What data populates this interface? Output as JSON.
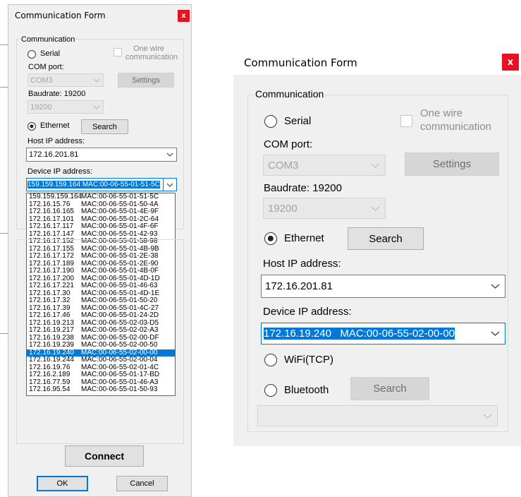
{
  "left_window": {
    "title": "Communication Form",
    "close_glyph": "x",
    "group_label": "Communication",
    "serial_label": "Serial",
    "one_wire_label_line1": "One wire",
    "one_wire_label_line2": "communication",
    "com_port_label": "COM port:",
    "com_port_value": "COM3",
    "settings_button": "Settings",
    "baudrate_label": "Baudrate: 19200",
    "baudrate_value": "19200",
    "ethernet_label": "Ethernet",
    "search_button": "Search",
    "host_ip_label": "Host IP address:",
    "host_ip_value": "172.16.201.81",
    "device_ip_label": "Device IP address:",
    "device_ip_value": "159.159.159.164 MAC:00-06-55-01-51-5C",
    "device_list": [
      {
        "ip": "159.159.159.164",
        "mac": "MAC:00-06-55-01-51-5C"
      },
      {
        "ip": "172.16.15.76",
        "mac": "MAC:00-06-55-01-50-4A"
      },
      {
        "ip": "172.16.16.165",
        "mac": "MAC:00-06-55-01-4E-9F"
      },
      {
        "ip": "172.16.17.101",
        "mac": "MAC:00-06-55-01-2C-64"
      },
      {
        "ip": "172.16.17.117",
        "mac": "MAC:00-06-55-01-4F-6F"
      },
      {
        "ip": "172.16.17.147",
        "mac": "MAC:00-06-55-01-42-93"
      },
      {
        "ip": "172.16.17.152",
        "mac": "MAC:00-06-55-01-58-98"
      },
      {
        "ip": "172.16.17.155",
        "mac": "MAC:00-06-55-01-4B-9B"
      },
      {
        "ip": "172.16.17.172",
        "mac": "MAC:00-06-55-01-2E-38"
      },
      {
        "ip": "172.16.17.189",
        "mac": "MAC:00-06-55-01-2E-90"
      },
      {
        "ip": "172.16.17.190",
        "mac": "MAC:00-06-55-01-4B-0F"
      },
      {
        "ip": "172.16.17.200",
        "mac": "MAC:00-06-55-01-4D-1D"
      },
      {
        "ip": "172.16.17.221",
        "mac": "MAC:00-06-55-01-46-63"
      },
      {
        "ip": "172.16.17.30",
        "mac": "MAC:00-06-55-01-4D-1E"
      },
      {
        "ip": "172.16.17.32",
        "mac": "MAC:00-06-55-01-50-20"
      },
      {
        "ip": "172.16.17.39",
        "mac": "MAC:00-06-55-01-4C-27"
      },
      {
        "ip": "172.16.17.46",
        "mac": "MAC:00-06-55-01-24-2D"
      },
      {
        "ip": "172.16.19.213",
        "mac": "MAC:00-06-55-02-03-D5"
      },
      {
        "ip": "172.16.19.217",
        "mac": "MAC:00-06-55-02-02-A3"
      },
      {
        "ip": "172.16.19.238",
        "mac": "MAC:00-06-55-02-00-DF"
      },
      {
        "ip": "172.16.19.239",
        "mac": "MAC:00-06-55-02-00-50"
      },
      {
        "ip": "172.16.19.240",
        "mac": "MAC:00-06-55-02-00-00",
        "selected": true
      },
      {
        "ip": "172.16.19.244",
        "mac": "MAC:00-06-55-02-00-04"
      },
      {
        "ip": "172.16.19.76",
        "mac": "MAC:00-06-55-02-01-4C"
      },
      {
        "ip": "172.16.2.189",
        "mac": "MAC:00-06-55-01-17-BD"
      },
      {
        "ip": "172.16.77.59",
        "mac": "MAC:00-06-55-01-46-A3"
      },
      {
        "ip": "172.16.95.54",
        "mac": "MAC:00-06-55-01-50-93"
      }
    ],
    "connect_button": "Connect",
    "ok_button": "OK",
    "cancel_button": "Cancel"
  },
  "right_window": {
    "title": "Communication Form",
    "close_glyph": "x",
    "group_label": "Communication",
    "serial_label": "Serial",
    "one_wire_label_line1": "One wire",
    "one_wire_label_line2": "communication",
    "com_port_label": "COM port:",
    "com_port_value": "COM3",
    "settings_button": "Settings",
    "baudrate_label": "Baudrate: 19200",
    "baudrate_value": "19200",
    "ethernet_label": "Ethernet",
    "search_button": "Search",
    "host_ip_label": "Host IP address:",
    "host_ip_value": "172.16.201.81",
    "device_ip_label": "Device IP address:",
    "device_ip_value": "172.16.19.240   MAC:00-06-55-02-00-00",
    "wifi_label": "WiFi(TCP)",
    "bluetooth_label": "Bluetooth",
    "bt_search_button": "Search",
    "bt_device_value": ""
  },
  "colors": {
    "selection": "#0078d7",
    "close_button": "#e81123",
    "window_bg": "#f0f0f0"
  },
  "icons": {
    "dropdown_arrow": "chevron-down-icon",
    "close": "close-icon"
  }
}
